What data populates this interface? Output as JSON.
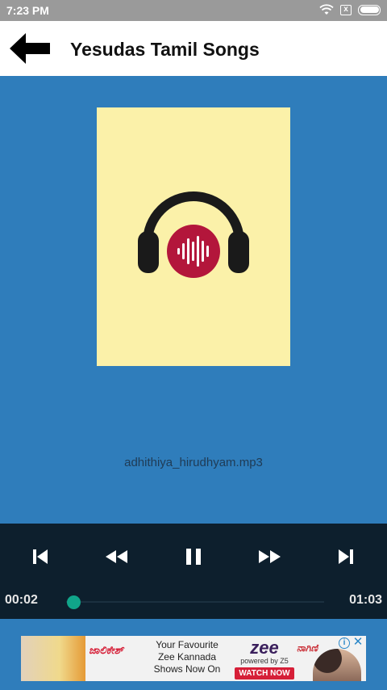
{
  "status_bar": {
    "time": "7:23 PM",
    "sim_icon": "x",
    "icons": [
      "wifi-icon",
      "sim-x-icon",
      "battery-icon"
    ],
    "battery_level": 1.0
  },
  "app_bar": {
    "title": "Yesudas Tamil Songs",
    "back_icon": "arrow-left-icon"
  },
  "album": {
    "background": "#fbf1a9",
    "icon": "headphones-icon",
    "accent": "#b3163b"
  },
  "now_playing": {
    "song": "adhithiya_hirudhyam.mp3"
  },
  "player": {
    "controls": [
      "skip-previous-icon",
      "rewind-icon",
      "pause-icon",
      "fast-forward-icon",
      "skip-next-icon"
    ],
    "current_time": "00:02",
    "total_time": "01:03",
    "progress": 0.03,
    "accent": "#10a58a"
  },
  "ad": {
    "brand_left": "ಜಾಲಿಕೇಶ್",
    "text_line1": "Your Favourite",
    "text_line2": "Zee Kannada",
    "text_line3": "Shows Now On",
    "zee_logo": "zee",
    "zee_sub": "powered by Z5",
    "cta": "WATCH NOW",
    "brand_right": "ನಾಗಿಣಿ",
    "info": "i",
    "close": "✕"
  },
  "colors": {
    "background": "#2f7dbb",
    "player_bg": "#0d1f2d",
    "status_bar": "#9a9a9a"
  }
}
